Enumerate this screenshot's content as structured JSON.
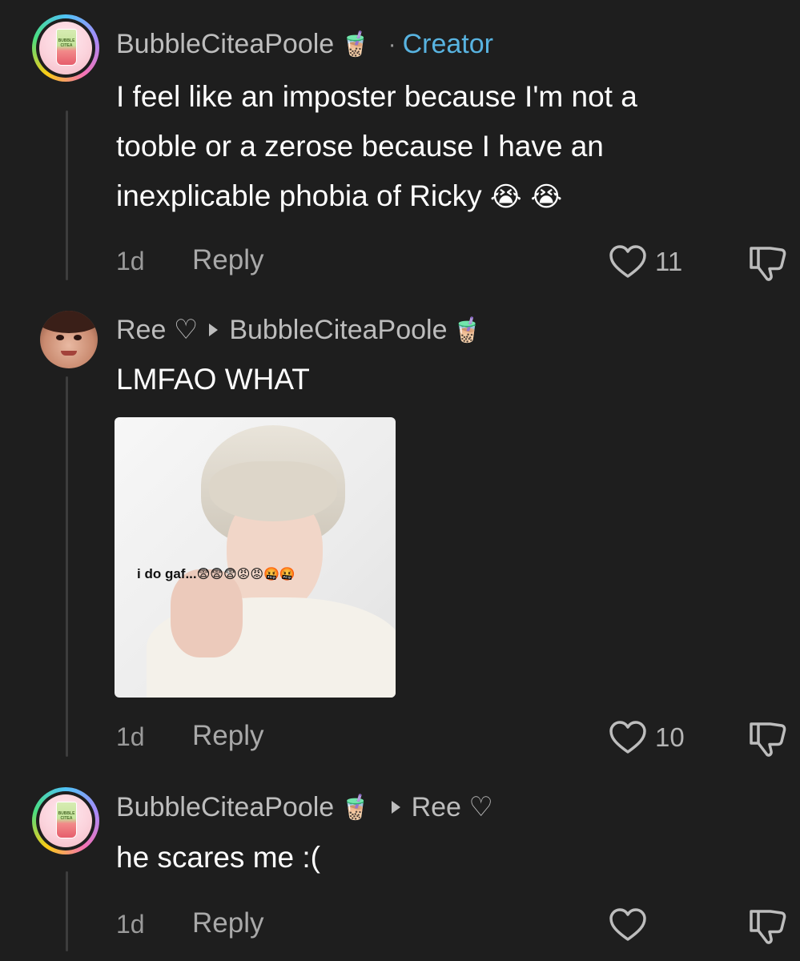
{
  "comments": [
    {
      "username": "BubbleCiteaPoole",
      "username_emoji": "🧋",
      "badge": "Creator",
      "separator": "·",
      "avatar_text": "BUBBLE CITEA",
      "text_lines": [
        "I feel like an imposter because I'm not a",
        "tooble or a zerose because I have an",
        "inexplicable phobia of Ricky"
      ],
      "text_emoji": "😭 😭",
      "time": "1d",
      "reply_label": "Reply",
      "like_count": "11"
    },
    {
      "username": "Ree ♡",
      "reply_to": "BubbleCiteaPoole",
      "reply_to_emoji": "🧋",
      "text": "LMFAO WHAT",
      "image_caption": "i do gaf...",
      "image_emojis": "😨😨😨😡😡🤬🤬",
      "time": "1d",
      "reply_label": "Reply",
      "like_count": "10"
    },
    {
      "username": "BubbleCiteaPoole",
      "username_emoji": "🧋",
      "reply_to": "Ree ♡",
      "avatar_text": "BUBBLE CITEA",
      "text": "he scares me :(",
      "time": "1d",
      "reply_label": "Reply",
      "like_count": ""
    }
  ],
  "icons": {
    "like": "heart-outline-icon",
    "dislike": "thumbs-down-outline-icon",
    "reply_arrow": "triangle-right-icon"
  },
  "colors": {
    "background": "#1e1e1e",
    "creator_badge": "#58b3e0",
    "username": "#bdbdbd",
    "meta": "#9a9a9a"
  }
}
